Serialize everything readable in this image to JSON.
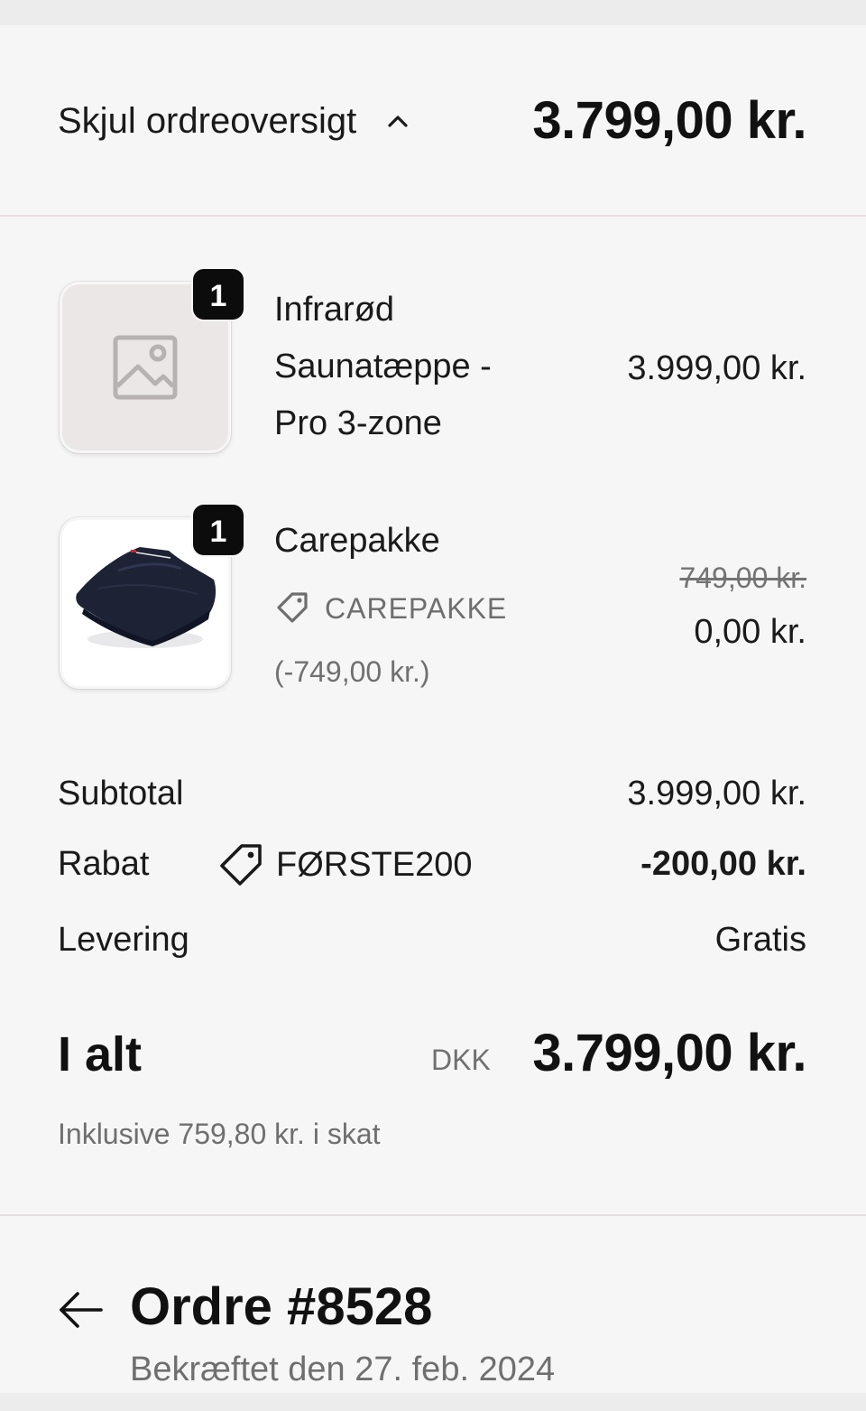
{
  "summary": {
    "toggle_label": "Skjul ordreoversigt",
    "total": "3.799,00 kr."
  },
  "items": [
    {
      "quantity": "1",
      "name_lines": [
        "Infrarød",
        "Saunatæppe -",
        "Pro 3-zone"
      ],
      "price": "3.999,00 kr.",
      "image": "image-placeholder-icon"
    },
    {
      "quantity": "1",
      "name": "Carepakke",
      "discount_code": "CAREPAKKE",
      "discount_amount": "(-749,00 kr.)",
      "original_price": "749,00 kr.",
      "price": "0,00 kr.",
      "image": "towel-photo"
    }
  ],
  "totals": {
    "subtotal_label": "Subtotal",
    "subtotal_value": "3.999,00 kr.",
    "discount_label": "Rabat",
    "discount_code": "FØRSTE200",
    "discount_value": "-200,00 kr.",
    "shipping_label": "Levering",
    "shipping_value": "Gratis",
    "total_label": "I alt",
    "currency": "DKK",
    "total_value": "3.799,00 kr.",
    "tax_note": "Inklusive 759,80 kr. i skat"
  },
  "order": {
    "title": "Ordre #8528",
    "confirmed": "Bekræftet den 27. feb. 2024"
  },
  "colors": {
    "panel_bg": "#f7f6f7",
    "divider": "#e7dfe1",
    "badge_bg": "#0c0c0c",
    "muted_text": "#6f6f6f"
  }
}
